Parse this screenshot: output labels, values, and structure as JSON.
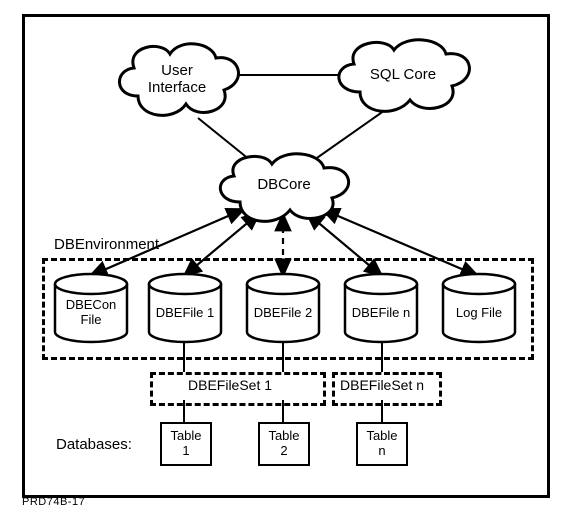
{
  "clouds": {
    "user_interface": "User\nInterface",
    "sql_core": "SQL Core",
    "dbcore": "DBCore"
  },
  "environment_label": "DBEnvironment",
  "cylinders": {
    "dbecon": "DBECon\nFile",
    "dbefile1": "DBEFile 1",
    "dbefile2": "DBEFile 2",
    "dbefilen": "DBEFile n",
    "logfile": "Log File"
  },
  "filesets": {
    "set1": "DBEFileSet 1",
    "setn": "DBEFileSet n"
  },
  "databases_label": "Databases:",
  "tables": {
    "t1": "Table\n1",
    "t2": "Table\n2",
    "tn": "Table\nn"
  },
  "footer": "PRD74B-17"
}
